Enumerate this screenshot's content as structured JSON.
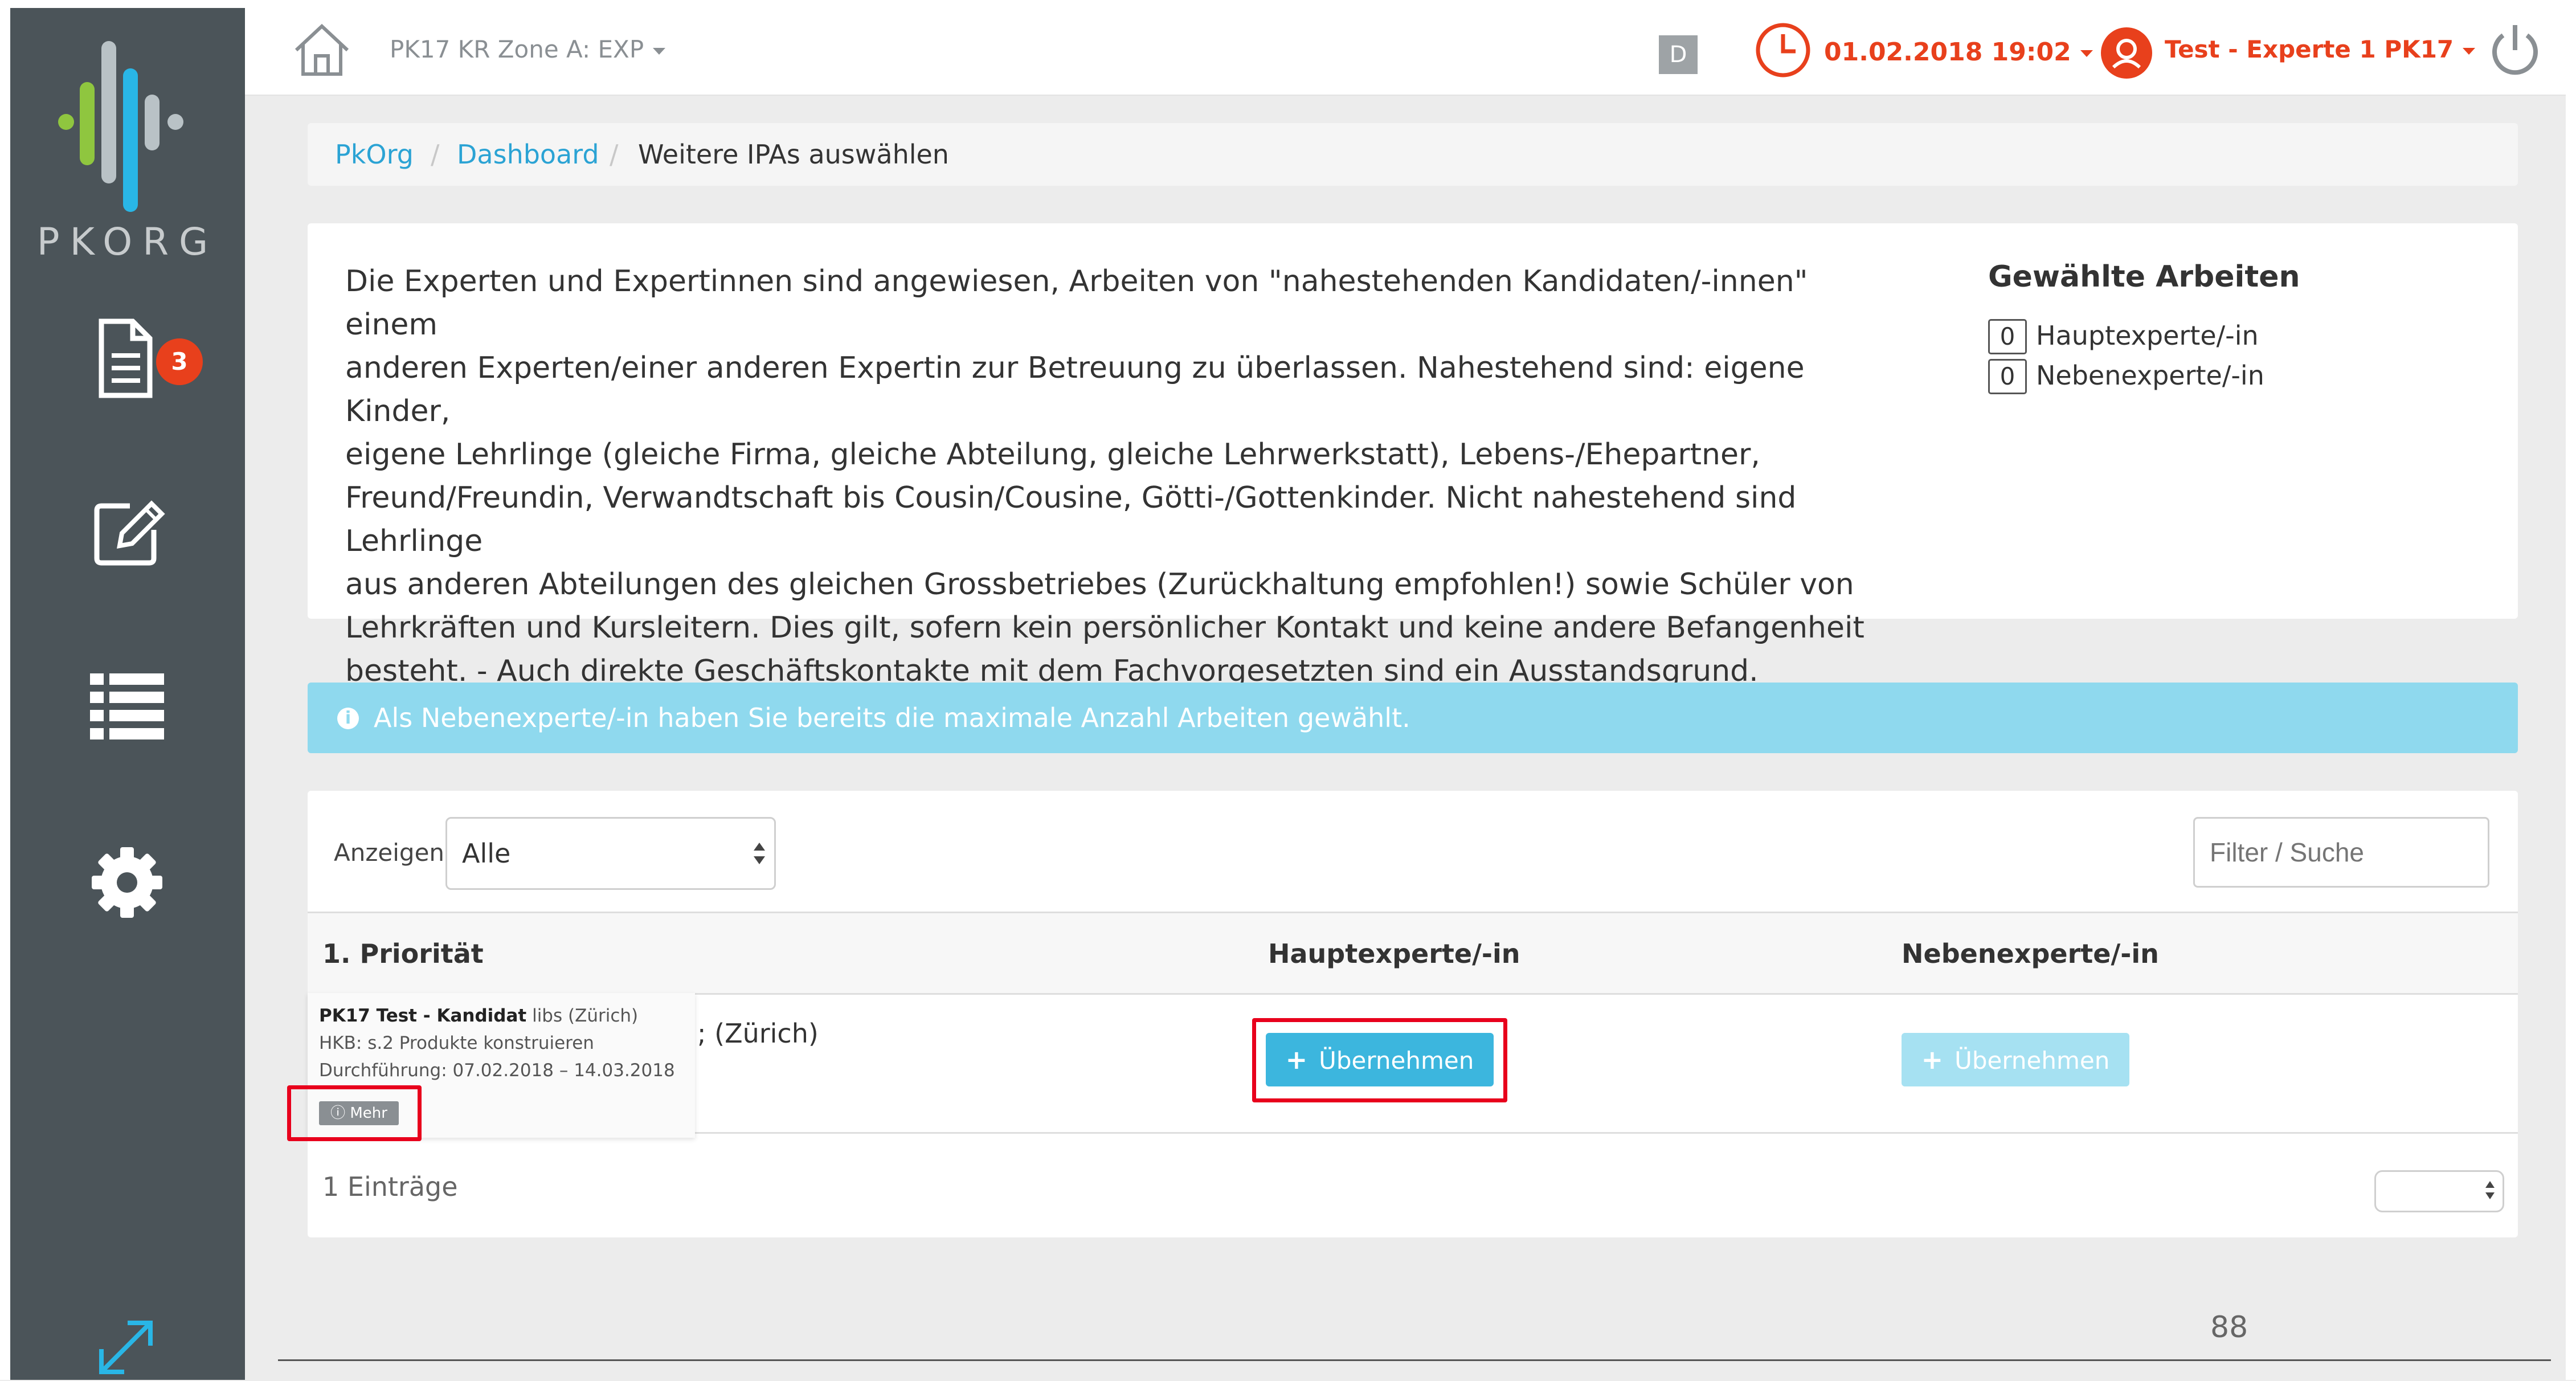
{
  "app": {
    "logo_text": "PKORG",
    "accent_color": "#e8401c",
    "info_color": "#8fd9ee",
    "link_color": "#2ba3d4",
    "sidebar_color": "#4b5459"
  },
  "sidebar": {
    "items": [
      {
        "icon": "document-icon",
        "badge": "3"
      },
      {
        "icon": "edit-icon"
      },
      {
        "icon": "list-icon"
      },
      {
        "icon": "settings-icon"
      }
    ],
    "bottom_icon": "expand-icon"
  },
  "topbar": {
    "zone": "PK17 KR Zone A: EXP",
    "mode_badge": "D",
    "datetime": "01.02.2018 19:02",
    "user": "Test - Experte 1 PK17"
  },
  "breadcrumb": {
    "items": [
      "PkOrg",
      "Dashboard",
      "Weitere IPAs auswählen"
    ]
  },
  "info_panel": {
    "lines": [
      "Die Experten und Expertinnen sind angewiesen, Arbeiten von \"nahestehenden Kandidaten/-innen\" einem",
      "anderen Experten/einer anderen Expertin zur Betreuung zu überlassen. Nahestehend sind: eigene Kinder,",
      "eigene Lehrlinge (gleiche Firma, gleiche Abteilung, gleiche Lehrwerkstatt), Lebens-/Ehepartner,",
      "Freund/Freundin, Verwandtschaft bis Cousin/Cousine, Götti-/Gottenkinder. Nicht nahestehend sind Lehrlinge",
      "aus anderen Abteilungen des gleichen Grossbetriebes (Zurückhaltung empfohlen!) sowie Schüler von",
      "Lehrkräften und Kursleitern. Dies gilt, sofern kein persönlicher Kontakt und keine andere Befangenheit",
      "besteht. - Auch direkte Geschäftskontakte mit dem Fachvorgesetzten sind ein Ausstandsgrund."
    ],
    "chosen_title": "Gewählte Arbeiten",
    "chosen": [
      {
        "count": "0",
        "label": "Hauptexperte/-in"
      },
      {
        "count": "0",
        "label": "Nebenexperte/-in"
      }
    ]
  },
  "alert": {
    "text": "Als Nebenexperte/-in haben Sie bereits die maximale Anzahl Arbeiten gewählt."
  },
  "table": {
    "show_label": "Anzeigen",
    "show_value": "Alle",
    "filter_placeholder": "Filter / Suche",
    "columns": [
      "1. Priorität",
      "Hauptexperte/-in",
      "Nebenexperte/-in"
    ],
    "rows": [
      {
        "tooltip_name": "PK17 Test - Kandidat",
        "tooltip_company": "libs (Zürich)",
        "tooltip_hkb": "HKB: s.2 Produkte konstruieren",
        "tooltip_period": "Durchführung: 07.02.2018 – 14.03.2018",
        "more_label": "Mehr",
        "visible_suffix": "; (Zürich)",
        "main_action": "Übernehmen",
        "side_action": "Übernehmen"
      }
    ],
    "entries_label": "1 Einträge"
  },
  "page_number": "88"
}
